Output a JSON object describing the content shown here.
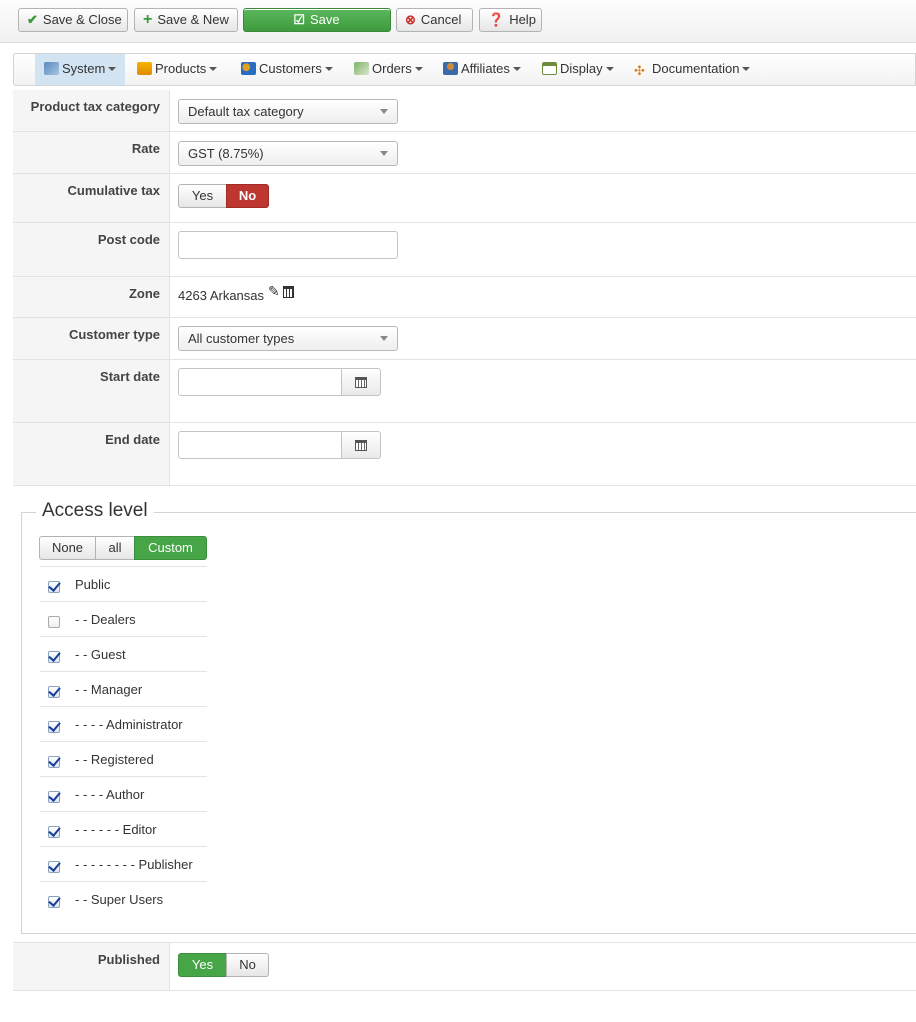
{
  "toolbar": {
    "save_close": "Save & Close",
    "save_new": "Save & New",
    "save": "Save",
    "cancel": "Cancel",
    "help": "Help"
  },
  "menu": [
    "System",
    "Products",
    "Customers",
    "Orders",
    "Affiliates",
    "Display",
    "Documentation"
  ],
  "form": {
    "product_tax_category": {
      "label": "Product tax category",
      "value": "Default tax category"
    },
    "rate": {
      "label": "Rate",
      "value": "GST (8.75%)"
    },
    "cumulative_tax": {
      "label": "Cumulative tax",
      "yes": "Yes",
      "no": "No",
      "selected": "No"
    },
    "post_code": {
      "label": "Post code",
      "value": ""
    },
    "zone": {
      "label": "Zone",
      "value": "4263 Arkansas"
    },
    "customer_type": {
      "label": "Customer type",
      "value": "All customer types"
    },
    "start_date": {
      "label": "Start date",
      "value": ""
    },
    "end_date": {
      "label": "End date",
      "value": ""
    },
    "published": {
      "label": "Published",
      "yes": "Yes",
      "no": "No",
      "selected": "Yes"
    }
  },
  "access_level": {
    "title": "Access level",
    "buttons": [
      "None",
      "all",
      "Custom"
    ],
    "selected": "Custom",
    "items": [
      {
        "label": "Public",
        "checked": true
      },
      {
        "label": "- - Dealers",
        "checked": false
      },
      {
        "label": "- - Guest",
        "checked": true
      },
      {
        "label": "- - Manager",
        "checked": true
      },
      {
        "label": "- - - - Administrator",
        "checked": true
      },
      {
        "label": "- - Registered",
        "checked": true
      },
      {
        "label": "- - - - Author",
        "checked": true
      },
      {
        "label": "- - - - - - Editor",
        "checked": true
      },
      {
        "label": "- - - - - - - - Publisher",
        "checked": true
      },
      {
        "label": "- - Super Users",
        "checked": true
      }
    ]
  }
}
